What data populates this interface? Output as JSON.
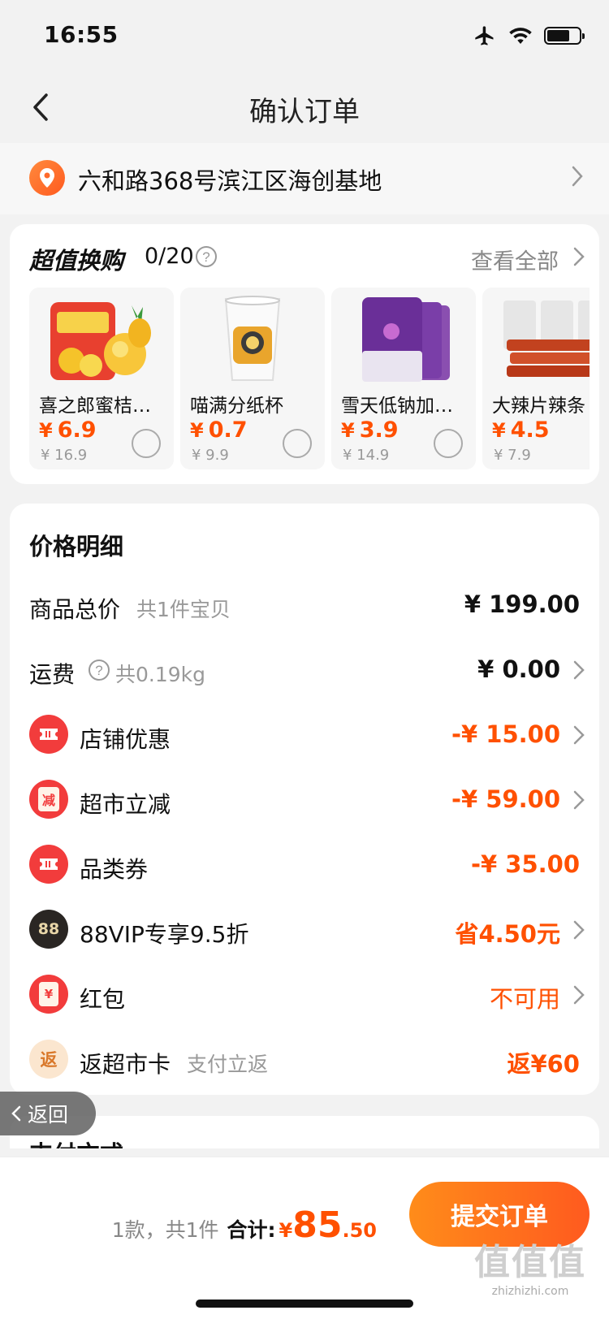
{
  "status": {
    "time": "16:55"
  },
  "nav": {
    "title": "确认订单"
  },
  "address": {
    "text": "六和路368号滨江区海创基地"
  },
  "exchange": {
    "title": "超值换购",
    "count": "0/20",
    "view_all": "查看全部",
    "items": [
      {
        "name": "喜之郎蜜桔…",
        "currency": "¥",
        "price": "6.9",
        "original": "¥ 16.9",
        "image": "candy-bag-image"
      },
      {
        "name": "喵满分纸杯",
        "currency": "¥",
        "price": "0.7",
        "original": "¥ 9.9",
        "image": "paper-cup-image"
      },
      {
        "name": "雪天低钠加…",
        "currency": "¥",
        "price": "3.9",
        "original": "¥ 14.9",
        "image": "salt-pack-image"
      },
      {
        "name": "大辣片辣条",
        "currency": "¥",
        "price": "4.5",
        "original": "¥ 7.9",
        "image": "spicy-strip-image"
      }
    ]
  },
  "pricing": {
    "title": "价格明细",
    "rows": [
      {
        "label": "商品总价",
        "sub": "共1件宝贝",
        "value": "¥ 199.00"
      },
      {
        "label": "运费",
        "sub": "共0.19kg",
        "value": "¥ 0.00"
      },
      {
        "label": "店铺优惠",
        "value": "-¥ 15.00",
        "icon": "ticket-icon"
      },
      {
        "label": "超市立减",
        "value": "-¥ 59.00",
        "icon": "reduce-icon",
        "icon_text": "减"
      },
      {
        "label": "品类券",
        "value": "-¥ 35.00",
        "icon": "ticket-icon"
      },
      {
        "label": "88VIP专享9.5折",
        "value": "省4.50元",
        "icon": "vip-88-icon",
        "icon_text": "88"
      },
      {
        "label": "红包",
        "value": "不可用",
        "icon": "red-packet-icon",
        "icon_text": "¥"
      },
      {
        "label": "返超市卡",
        "sub": "支付立返",
        "value": "返¥60",
        "icon": "return-card-icon",
        "icon_text": "返"
      }
    ]
  },
  "float_back": {
    "label": "返回"
  },
  "payment": {
    "title": "支付方式"
  },
  "bottom": {
    "count": "1款，共1件",
    "total_label": "合计:",
    "currency": "¥",
    "total_int": "85",
    "total_dec": ".50",
    "submit": "提交订单"
  },
  "watermark": {
    "big": "值值值",
    "small": "zhizhizhi.com"
  },
  "colors": {
    "accent": "#ff5000",
    "submit_start": "#ff8c1a",
    "submit_end": "#ff5a1f",
    "coupon_red": "#f23c3c",
    "vip_dark": "#2a2623"
  }
}
